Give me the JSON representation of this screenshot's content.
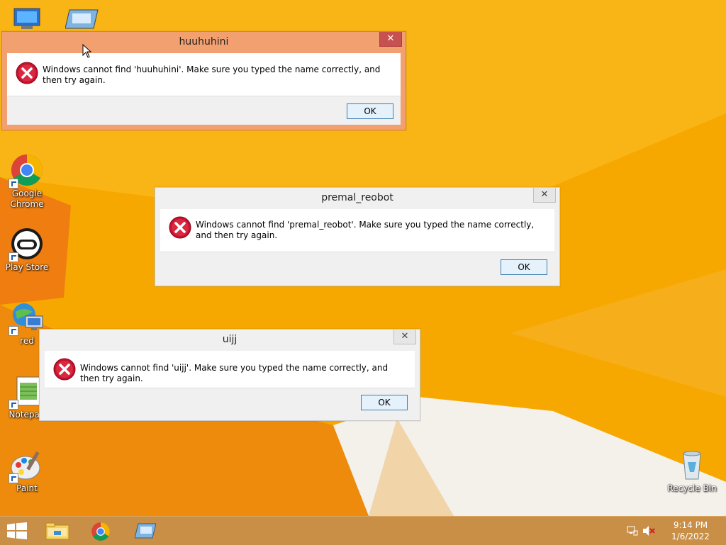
{
  "desktop": {
    "icons": [
      {
        "label": "Google Chrome",
        "name": "chrome-icon"
      },
      {
        "label": "Play Store",
        "name": "play-store-icon"
      },
      {
        "label": "red",
        "name": "network-computer-icon"
      },
      {
        "label": "Notepad",
        "name": "notepad-icon"
      },
      {
        "label": "Paint",
        "name": "paint-icon"
      },
      {
        "label": "Recycle Bin",
        "name": "recycle-bin-icon"
      }
    ]
  },
  "dialogs": [
    {
      "title": "huuhuhini",
      "message": "Windows cannot find 'huuhuhini'. Make sure you typed the name correctly, and then try again.",
      "ok": "OK",
      "close": "✕"
    },
    {
      "title": "premal_reobot",
      "message": "Windows cannot find 'premal_reobot'. Make sure you typed the name correctly, and then try again.",
      "ok": "OK",
      "close": "✕"
    },
    {
      "title": "uijj",
      "message": "Windows cannot find 'uijj'. Make sure you typed the name correctly, and then try again.",
      "ok": "OK",
      "close": "✕"
    }
  ],
  "taskbar": {
    "time": "9:14 PM",
    "date": "1/6/2022",
    "pinned": [
      "start-icon",
      "file-explorer-icon",
      "chrome-icon",
      "run-icon"
    ]
  },
  "colors": {
    "wallpaper": "#f5a300",
    "taskbar": "#c98f46",
    "active_frame": "#f2a070",
    "error_red": "#c8102e"
  }
}
